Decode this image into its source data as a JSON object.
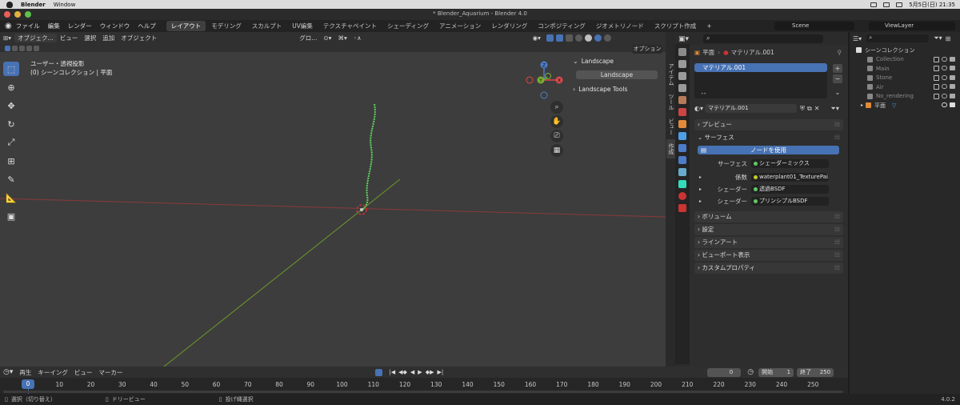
{
  "macbar": {
    "app": "Blender",
    "window_menu": "Window",
    "datetime": "5月5日(日) 21:35"
  },
  "titlebar": {
    "title": "* Blender_Aquarium - Blender 4.0"
  },
  "menus": [
    "ファイル",
    "編集",
    "レンダー",
    "ウィンドウ",
    "ヘルプ"
  ],
  "workspaces": [
    "レイアウト",
    "モデリング",
    "スカルプト",
    "UV編集",
    "テクスチャペイント",
    "シェーディング",
    "アニメーション",
    "レンダリング",
    "コンポジティング",
    "ジオメトリノード",
    "スクリプト作成"
  ],
  "workspace_add": "+",
  "scene": {
    "name": "Scene",
    "view_layer": "ViewLayer"
  },
  "viewport": {
    "mode": "オブジェク...",
    "menus": [
      "ビュー",
      "選択",
      "追加",
      "オブジェクト"
    ],
    "transform": "グロ...",
    "options": "オプション",
    "info_line1": "ユーザー・透視投影",
    "info_line2": "(0) シーンコレクション | 平面",
    "axis_labels": {
      "z": "Z",
      "x": "X",
      "y": "Y"
    }
  },
  "npanel": {
    "header": "Landscape",
    "button": "Landscape",
    "tools": "Landscape Tools",
    "tabs": [
      "アイテム",
      "ツール",
      "ビュー",
      "作成"
    ]
  },
  "properties": {
    "breadcrumb_obj": "平面",
    "breadcrumb_mat": "マテリアル.001",
    "slot": "マテリアル.001",
    "material_name": "マテリアル.001",
    "use_nodes": "ノードを使用",
    "surface_label": "サーフェス",
    "surface_value": "シェーダーミックス",
    "fac_label": "係数",
    "fac_value": "waterplant01_TexturePai...",
    "shader1_label": "シェーダー",
    "shader1_value": "透過BSDF",
    "shader2_label": "シェーダー",
    "shader2_value": "プリンシプルBSDF",
    "sections": {
      "preview": "プレビュー",
      "surface": "サーフェス",
      "volume": "ボリューム",
      "settings": "設定",
      "lineart": "ラインアート",
      "viewport_display": "ビューポート表示",
      "custom_props": "カスタムプロパティ"
    }
  },
  "outliner": {
    "root": "シーンコレクション",
    "items": [
      {
        "name": "Collection",
        "dim": true
      },
      {
        "name": "Main",
        "dim": true
      },
      {
        "name": "Stone",
        "dim": true
      },
      {
        "name": "Air",
        "dim": true
      },
      {
        "name": "No_rendering",
        "dim": true
      },
      {
        "name": "平面",
        "dim": false
      }
    ]
  },
  "timeline": {
    "menus": [
      "再生",
      "キーイング",
      "ビュー",
      "マーカー"
    ],
    "current_frame": "0",
    "frame_field": "0",
    "start_label": "開始",
    "start": "1",
    "end_label": "終了",
    "end": "250",
    "ticks": [
      "10",
      "20",
      "30",
      "40",
      "50",
      "60",
      "70",
      "80",
      "90",
      "100",
      "110",
      "120",
      "130",
      "140",
      "150",
      "160",
      "170",
      "180",
      "190",
      "200",
      "210",
      "220",
      "230",
      "240",
      "250"
    ]
  },
  "status": {
    "select": "選択（切り替え）",
    "dolly": "ドリービュー",
    "lasso": "投げ縄選択",
    "version": "4.0.2"
  },
  "colors": {
    "accent": "#4772b3",
    "grid_x": "#8a3a3a",
    "grid_y": "#6e9a2a",
    "selection": "#5fd35f"
  }
}
